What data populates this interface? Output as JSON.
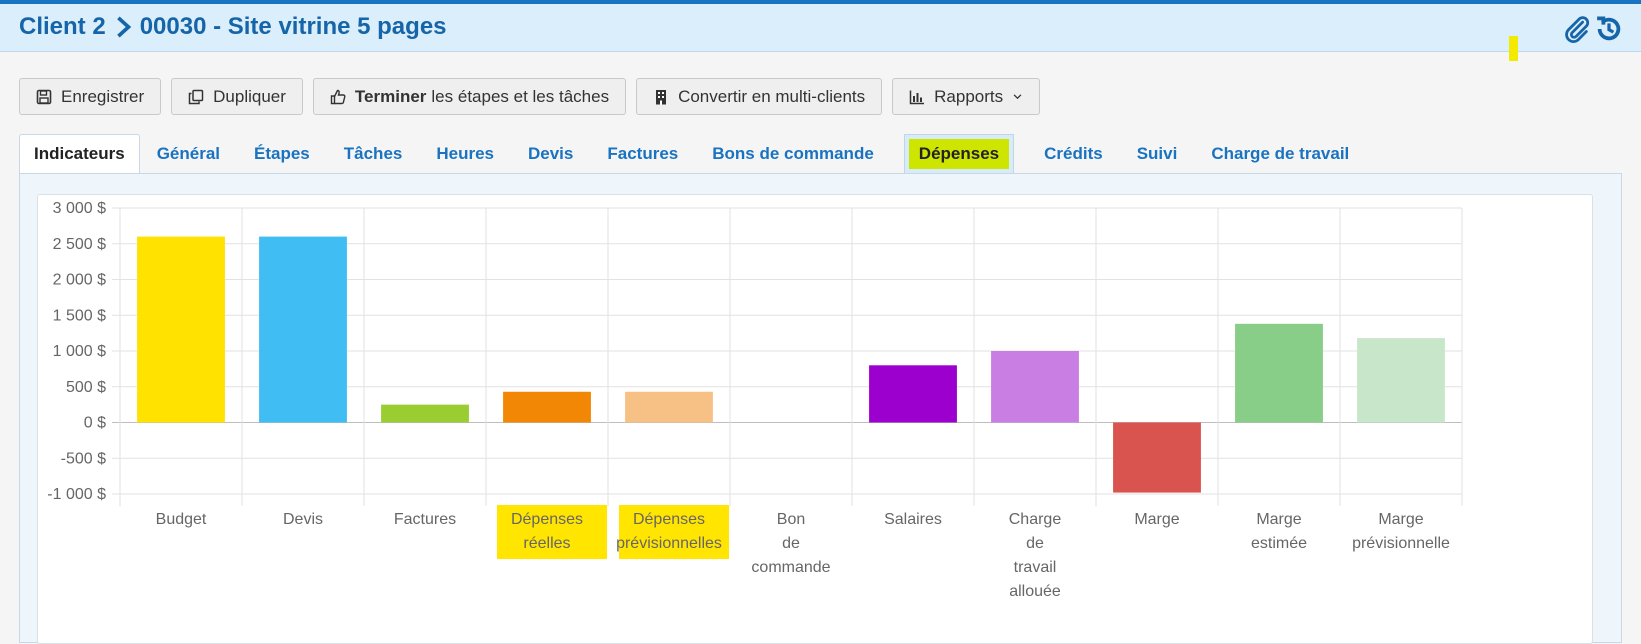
{
  "header": {
    "client": "Client 2",
    "project": "00030 - Site vitrine 5 pages",
    "icons": [
      "paperclip-icon",
      "history-icon"
    ],
    "accent": "#1565a8"
  },
  "toolbar": {
    "save_label": "Enregistrer",
    "duplicate_label": "Dupliquer",
    "finish_bold": "Terminer",
    "finish_rest": "les étapes et les tâches",
    "convert_label": "Convertir en multi-clients",
    "reports_label": "Rapports"
  },
  "tabs": [
    {
      "label": "Indicateurs",
      "active": true
    },
    {
      "label": "Général"
    },
    {
      "label": "Étapes"
    },
    {
      "label": "Tâches"
    },
    {
      "label": "Heures"
    },
    {
      "label": "Devis"
    },
    {
      "label": "Factures"
    },
    {
      "label": "Bons de commande"
    },
    {
      "label": "Dépenses",
      "highlighted": true
    },
    {
      "label": "Crédits"
    },
    {
      "label": "Suivi"
    },
    {
      "label": "Charge de travail"
    }
  ],
  "chart_data": {
    "type": "bar",
    "categories": [
      [
        "Budget"
      ],
      [
        "Devis"
      ],
      [
        "Factures"
      ],
      [
        "Dépenses",
        "réelles"
      ],
      [
        "Dépenses",
        "prévisionnelles"
      ],
      [
        "Bon",
        "de",
        "commande"
      ],
      [
        "Salaires"
      ],
      [
        "Charge",
        "de",
        "travail",
        "allouée"
      ],
      [
        "Marge"
      ],
      [
        "Marge",
        "estimée"
      ],
      [
        "Marge",
        "prévisionnelle"
      ]
    ],
    "values": [
      2600,
      2600,
      250,
      430,
      430,
      0,
      800,
      1000,
      -980,
      1380,
      1180
    ],
    "colors": [
      "#ffe200",
      "#40bdf2",
      "#9acd32",
      "#f28705",
      "#f7c185",
      "#cccccc",
      "#9c00cf",
      "#c97ee3",
      "#d9534f",
      "#88cd88",
      "#c8e6c9"
    ],
    "yticks": [
      "3 000 $",
      "2 500 $",
      "2 000 $",
      "1 500 $",
      "1 000 $",
      "500 $",
      "0 $",
      "-500 $",
      "-1 000 $"
    ],
    "ylim": [
      -1000,
      3000
    ],
    "grid": true,
    "highlighted_labels": [
      3,
      4
    ]
  }
}
